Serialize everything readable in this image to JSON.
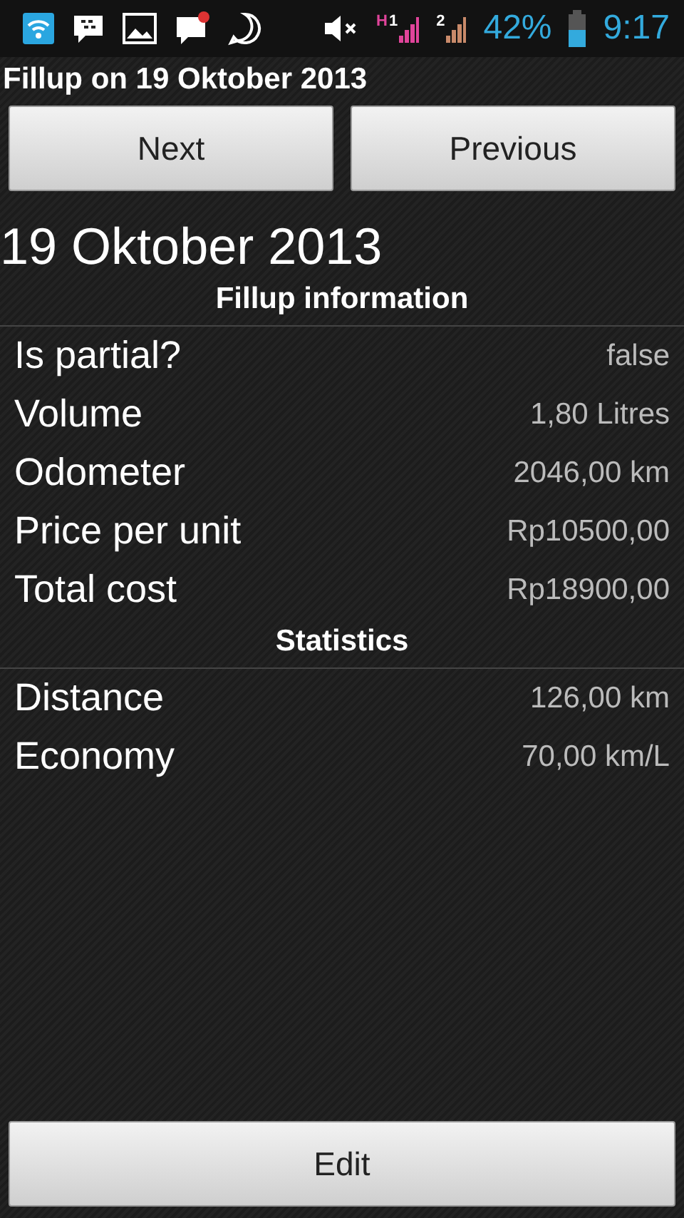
{
  "status_bar": {
    "network_label": "H",
    "sim_1": "1",
    "sim_2": "2",
    "battery": "42%",
    "time": "9:17"
  },
  "title": "Fillup on 19 Oktober 2013",
  "nav_buttons": [
    "Next",
    "Previous"
  ],
  "date": "19 Oktober 2013",
  "sections": [
    {
      "title": "Fillup information",
      "rows": [
        {
          "label": "Is partial?",
          "value": "false"
        },
        {
          "label": "Volume",
          "value": "1,80 Litres"
        },
        {
          "label": "Odometer",
          "value": "2046,00 km"
        },
        {
          "label": "Price per unit",
          "value": "Rp10500,00"
        },
        {
          "label": "Total cost",
          "value": "Rp18900,00"
        }
      ]
    },
    {
      "title": "Statistics",
      "rows": [
        {
          "label": "Distance",
          "value": "126,00 km"
        },
        {
          "label": "Economy",
          "value": "70,00 km/L"
        }
      ]
    }
  ],
  "edit_button": "Edit"
}
